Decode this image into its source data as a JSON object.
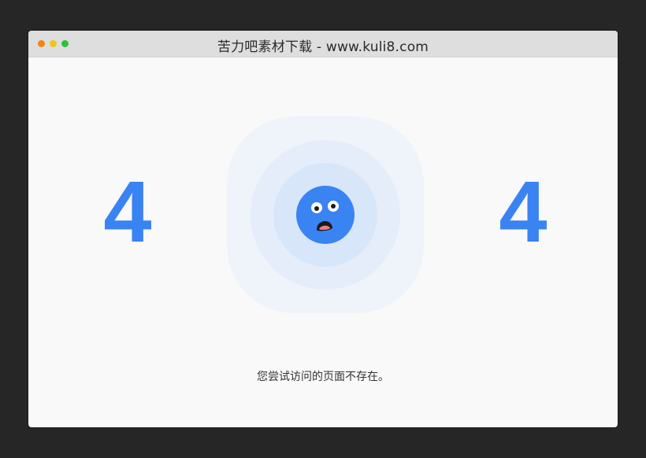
{
  "window": {
    "title": "苦力吧素材下载 - www.kuli8.com"
  },
  "error": {
    "digit_left": "4",
    "digit_right": "4",
    "message": "您尝试访问的页面不存在。"
  },
  "colors": {
    "accent": "#3a83f2",
    "face": "#3a83f2",
    "mouth_inner": "#1b1b1b",
    "tongue": "#f08080",
    "window_bg": "#f9f9fa",
    "titlebar_bg": "#dedede",
    "dot_red": "#f5840f",
    "dot_yellow": "#f0c418",
    "dot_green": "#2cc13e"
  },
  "icons": {
    "face": "shocked-face-icon"
  }
}
